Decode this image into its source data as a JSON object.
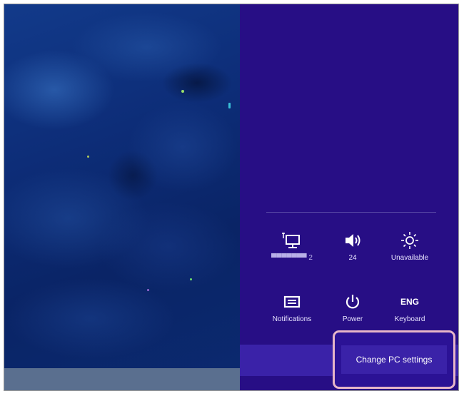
{
  "quick_settings": [
    {
      "id": "network",
      "icon": "network-icon",
      "label": "▀▀▀▀▀▀▀ 2"
    },
    {
      "id": "volume",
      "icon": "volume-icon",
      "label": "24"
    },
    {
      "id": "brightness",
      "icon": "brightness-icon",
      "label": "Unavailable"
    },
    {
      "id": "notifications",
      "icon": "notifications-icon",
      "label": "Notifications"
    },
    {
      "id": "power",
      "icon": "power-icon",
      "label": "Power"
    },
    {
      "id": "keyboard",
      "icon": "keyboard-icon",
      "label": "Keyboard",
      "icon_text": "ENG"
    }
  ],
  "change_pc_settings": {
    "label": "Change PC settings"
  },
  "colors": {
    "charms_background": "#270e85",
    "highlight_border": "#e7b6c8",
    "button_background": "#3a22a8"
  }
}
